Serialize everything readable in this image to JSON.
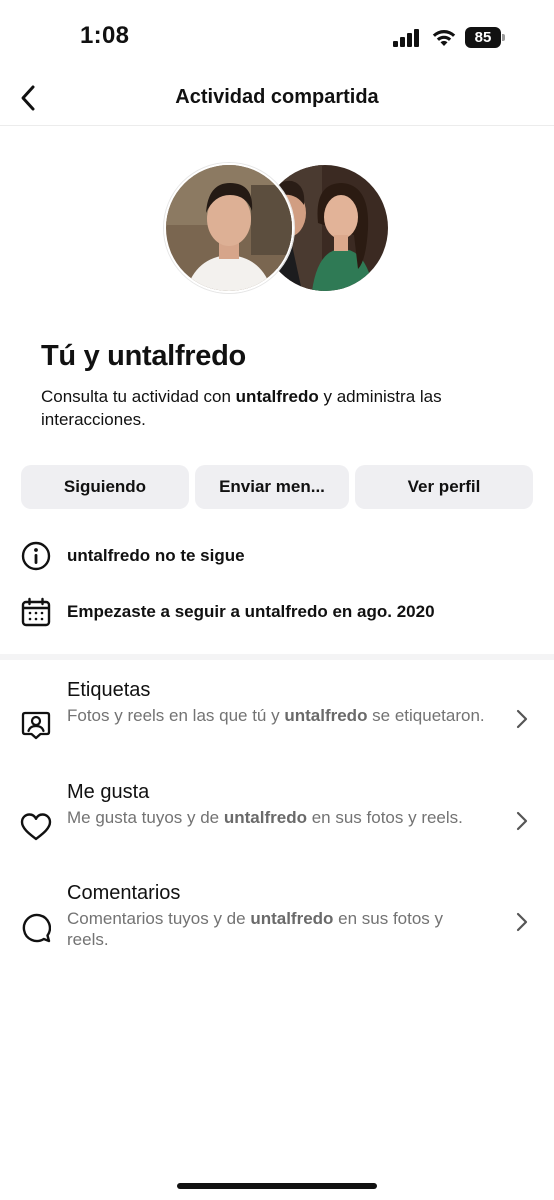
{
  "status_bar": {
    "time": "1:08",
    "battery": "85"
  },
  "header": {
    "title": "Actividad compartida",
    "back_icon": "chevron-left-icon"
  },
  "profile": {
    "title": "Tú y untalfredo",
    "desc_prefix": "Consulta tu actividad con ",
    "desc_username": "untalfredo",
    "desc_suffix": " y administra las interacciones."
  },
  "actions": {
    "following_label": "Siguiendo",
    "message_label": "Enviar men...",
    "profile_label": "Ver perfil"
  },
  "info": {
    "not_following": "untalfredo no te sigue",
    "not_following_icon": "info-icon",
    "followed_since": "Empezaste a seguir a untalfredo en ago. 2020",
    "followed_since_icon": "calendar-icon"
  },
  "items": [
    {
      "title": "Etiquetas",
      "sub_prefix": "Fotos y reels en las que tú y ",
      "sub_user": "untalfredo",
      "sub_suffix": " se etiquetaron.",
      "icon": "tag-person-icon"
    },
    {
      "title": "Me gusta",
      "sub_prefix": "Me gusta tuyos y de ",
      "sub_user": "untalfredo",
      "sub_suffix": " en sus fotos y reels.",
      "icon": "heart-icon"
    },
    {
      "title": "Comentarios",
      "sub_prefix": "Comentarios tuyos y de ",
      "sub_user": "untalfredo",
      "sub_suffix": " en sus fotos y reels.",
      "icon": "comment-icon"
    }
  ],
  "colors": {
    "text": "#111111",
    "secondary_text": "#737373",
    "button_bg": "#efeff2",
    "divider": "#f4f4f5"
  }
}
